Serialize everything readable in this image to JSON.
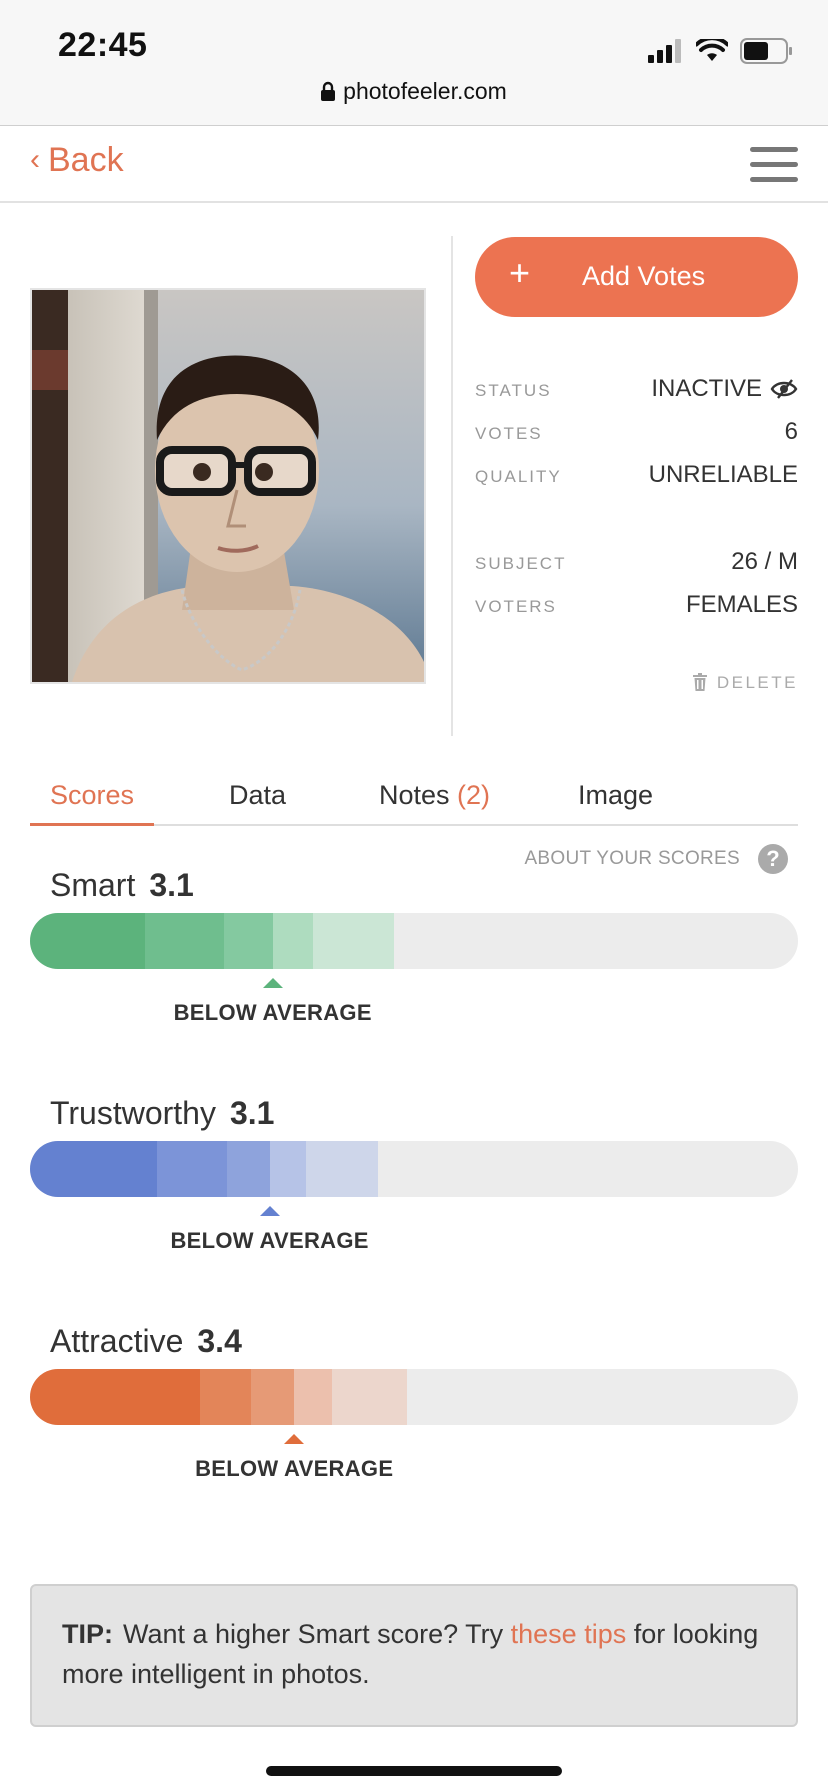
{
  "status_bar": {
    "time": "22:45",
    "url": "photofeeler.com"
  },
  "nav": {
    "back_label": "Back"
  },
  "add_votes": {
    "plus": "+",
    "label": "Add Votes"
  },
  "details": {
    "status_key": "STATUS",
    "status_value": "INACTIVE",
    "votes_key": "VOTES",
    "votes_value": "6",
    "quality_key": "QUALITY",
    "quality_value": "UNRELIABLE",
    "subject_key": "SUBJECT",
    "subject_value": "26 / M",
    "voters_key": "VOTERS",
    "voters_value": "FEMALES",
    "delete_label": "DELETE"
  },
  "tabs": [
    {
      "label": "Scores",
      "active": true
    },
    {
      "label": "Data"
    },
    {
      "label": "Notes ",
      "count": "(2)"
    },
    {
      "label": "Image"
    }
  ],
  "about_scores": "ABOUT YOUR SCORES",
  "scores": [
    {
      "name": "Smart",
      "value": "3.1",
      "verdict": "BELOW AVERAGE",
      "marker_fraction": 0.316,
      "color": "#5cb37c",
      "segments": [
        {
          "end_fraction": 0.15,
          "color": "#5cb37c"
        },
        {
          "end_fraction": 0.253,
          "color": "#6fbe8e"
        },
        {
          "end_fraction": 0.316,
          "color": "#84c9a0"
        },
        {
          "end_fraction": 0.369,
          "color": "#aedcbf"
        },
        {
          "end_fraction": 0.474,
          "color": "#cbe6d5"
        }
      ]
    },
    {
      "name": "Trustworthy",
      "value": "3.1",
      "verdict": "BELOW AVERAGE",
      "marker_fraction": 0.312,
      "color": "#6481d0",
      "segments": [
        {
          "end_fraction": 0.165,
          "color": "#6481d0"
        },
        {
          "end_fraction": 0.256,
          "color": "#7c94d8"
        },
        {
          "end_fraction": 0.312,
          "color": "#8ea3dc"
        },
        {
          "end_fraction": 0.359,
          "color": "#b6c3e7"
        },
        {
          "end_fraction": 0.453,
          "color": "#ced6ea"
        }
      ]
    },
    {
      "name": "Attractive",
      "value": "3.4",
      "verdict": "BELOW AVERAGE",
      "marker_fraction": 0.344,
      "color": "#e06d3b",
      "segments": [
        {
          "end_fraction": 0.221,
          "color": "#e06d3b"
        },
        {
          "end_fraction": 0.288,
          "color": "#e38559"
        },
        {
          "end_fraction": 0.344,
          "color": "#e69a76"
        },
        {
          "end_fraction": 0.393,
          "color": "#ecc0ad"
        },
        {
          "end_fraction": 0.491,
          "color": "#ecd6cc"
        }
      ]
    }
  ],
  "tip": {
    "lead": "TIP:",
    "text_before": "Want a higher Smart score? Try ",
    "link": "these tips",
    "text_after": " for looking more intelligent in photos."
  }
}
